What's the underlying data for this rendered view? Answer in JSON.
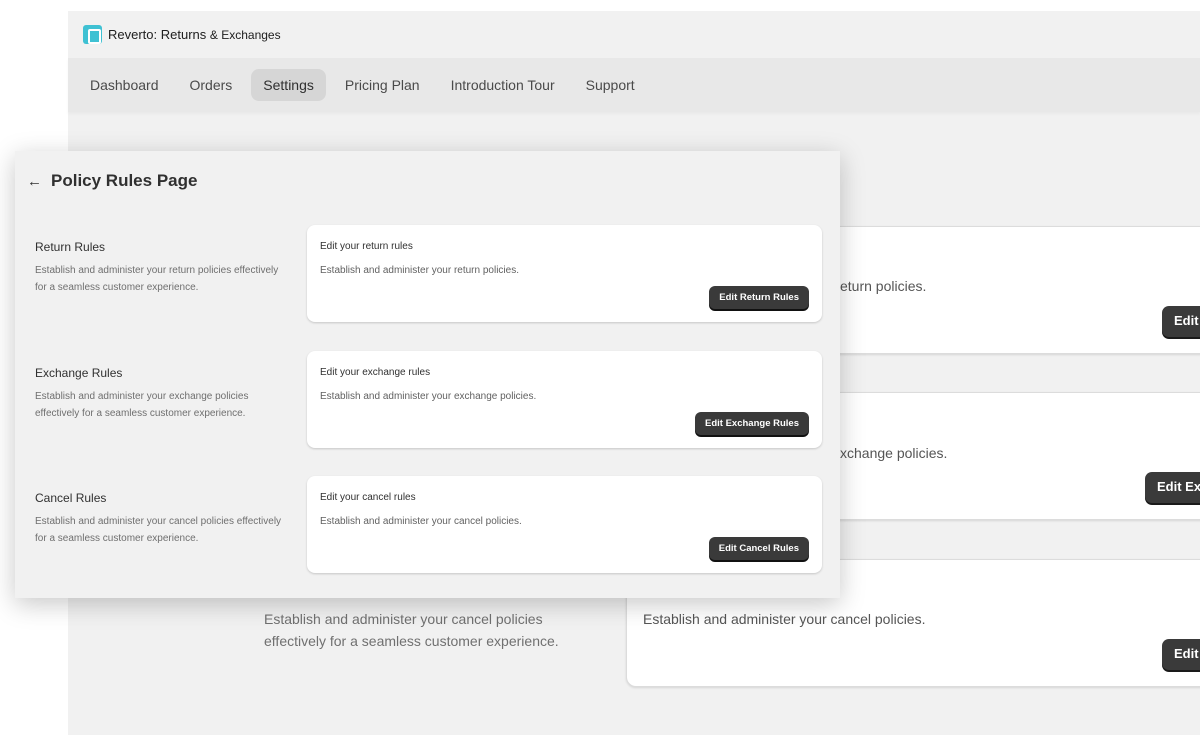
{
  "app": {
    "title": "Reverto: Returns",
    "title_suffix": "& Exchanges",
    "logo_icon": "reverto-logo-icon",
    "accent": "#3fc1d3"
  },
  "nav": {
    "items": [
      "Dashboard",
      "Orders",
      "Settings",
      "Pricing Plan",
      "Introduction Tour",
      "Support"
    ],
    "active": "Settings"
  },
  "background": {
    "return_card_text": "eturn policies.",
    "exchange_card_text": "xchange policies.",
    "cancel_card_text": "Establish and administer your cancel policies.",
    "cancel_desc": "Establish and administer your cancel policies effectively for a seamless customer experience.",
    "btn_return": "Edit",
    "btn_exchange": "Edit Ex",
    "btn_cancel": "Edit"
  },
  "panel": {
    "back_icon": "arrow-left-icon",
    "title": "Policy Rules Page",
    "sections": [
      {
        "title": "Return Rules",
        "desc": "Establish and administer your return policies effectively for a seamless customer experience.",
        "card_title": "Edit your return rules",
        "card_desc": "Establish and administer your return policies.",
        "button": "Edit Return Rules"
      },
      {
        "title": "Exchange Rules",
        "desc": "Establish and administer your exchange policies effectively for a seamless customer experience.",
        "card_title": "Edit your exchange rules",
        "card_desc": "Establish and administer your exchange policies.",
        "button": "Edit Exchange Rules"
      },
      {
        "title": "Cancel Rules",
        "desc": "Establish and administer your cancel policies effectively for a seamless customer experience.",
        "card_title": "Edit your cancel rules",
        "card_desc": "Establish and administer your cancel policies.",
        "button": "Edit Cancel Rules"
      }
    ]
  }
}
